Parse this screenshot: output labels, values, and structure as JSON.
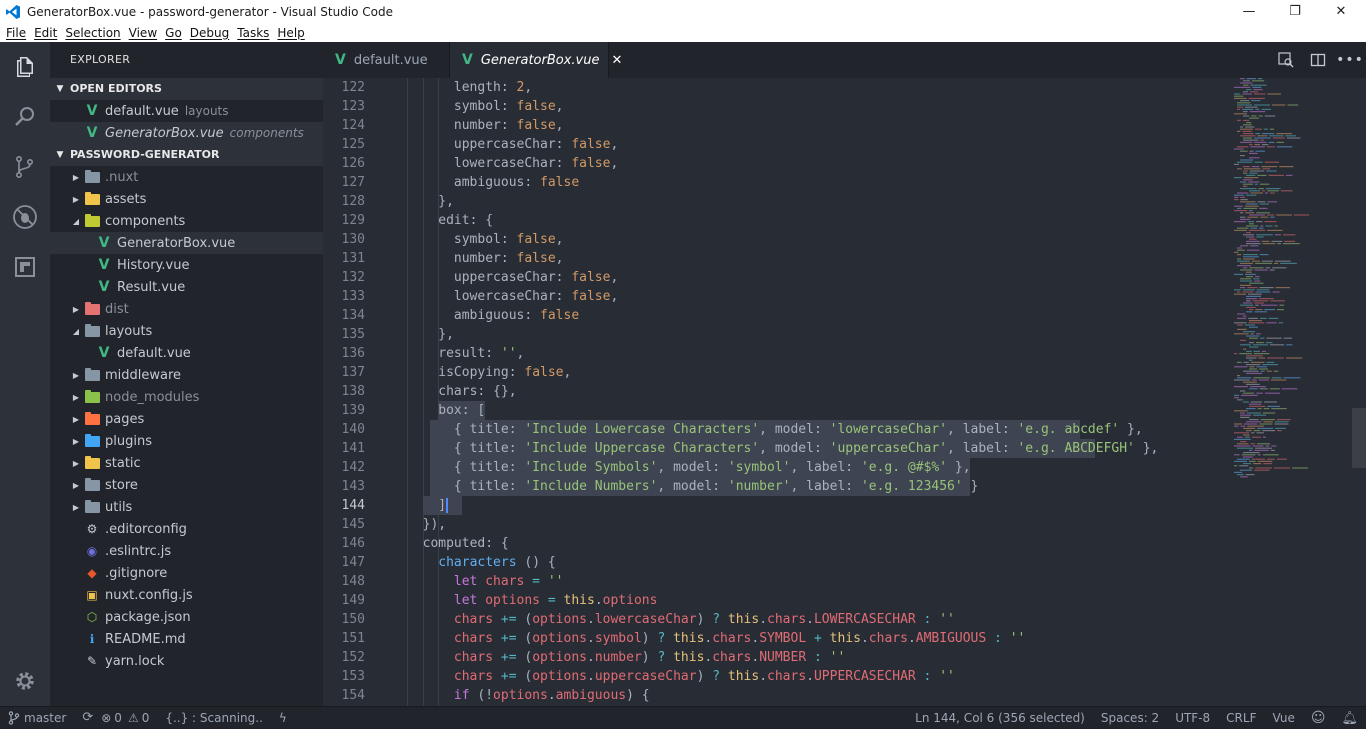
{
  "window": {
    "title": "GeneratorBox.vue - password-generator - Visual Studio Code",
    "minimize": "—",
    "maximize": "❐",
    "close": "✕"
  },
  "menu": [
    "File",
    "Edit",
    "Selection",
    "View",
    "Go",
    "Debug",
    "Tasks",
    "Help"
  ],
  "sidebar": {
    "title": "EXPLORER",
    "open_editors_label": "OPEN EDITORS",
    "open_editors": [
      {
        "name": "default.vue",
        "desc": "layouts"
      },
      {
        "name": "GeneratorBox.vue",
        "desc": "components"
      }
    ],
    "project_label": "PASSWORD-GENERATOR",
    "tree": [
      {
        "name": ".nuxt",
        "type": "folder",
        "expanded": false,
        "depth": 0,
        "color": "#8796a4",
        "dimmed": true
      },
      {
        "name": "assets",
        "type": "folder",
        "expanded": false,
        "depth": 0,
        "color": "#f0c34a"
      },
      {
        "name": "components",
        "type": "folder",
        "expanded": true,
        "depth": 0,
        "color": "#c0ca33"
      },
      {
        "name": "GeneratorBox.vue",
        "type": "vue",
        "depth": 1,
        "active": true
      },
      {
        "name": "History.vue",
        "type": "vue",
        "depth": 1
      },
      {
        "name": "Result.vue",
        "type": "vue",
        "depth": 1
      },
      {
        "name": "dist",
        "type": "folder",
        "expanded": false,
        "depth": 0,
        "color": "#e57373",
        "dimmed": true
      },
      {
        "name": "layouts",
        "type": "folder",
        "expanded": true,
        "depth": 0,
        "color": "#8796a4"
      },
      {
        "name": "default.vue",
        "type": "vue",
        "depth": 1
      },
      {
        "name": "middleware",
        "type": "folder",
        "expanded": false,
        "depth": 0,
        "color": "#8796a4"
      },
      {
        "name": "node_modules",
        "type": "folder",
        "expanded": false,
        "depth": 0,
        "color": "#8bc34a",
        "dimmed": true
      },
      {
        "name": "pages",
        "type": "folder",
        "expanded": false,
        "depth": 0,
        "color": "#ff7043"
      },
      {
        "name": "plugins",
        "type": "folder",
        "expanded": false,
        "depth": 0,
        "color": "#42a5f5"
      },
      {
        "name": "static",
        "type": "folder",
        "expanded": false,
        "depth": 0,
        "color": "#f0c34a"
      },
      {
        "name": "store",
        "type": "folder",
        "expanded": false,
        "depth": 0,
        "color": "#8796a4"
      },
      {
        "name": "utils",
        "type": "folder",
        "expanded": false,
        "depth": 0,
        "color": "#8796a4"
      },
      {
        "name": ".editorconfig",
        "type": "file",
        "depth": 0,
        "icon": "gear"
      },
      {
        "name": ".eslintrc.js",
        "type": "file",
        "depth": 0,
        "icon": "eslint"
      },
      {
        "name": ".gitignore",
        "type": "file",
        "depth": 0,
        "icon": "git"
      },
      {
        "name": "nuxt.config.js",
        "type": "file",
        "depth": 0,
        "icon": "js"
      },
      {
        "name": "package.json",
        "type": "file",
        "depth": 0,
        "icon": "npm"
      },
      {
        "name": "README.md",
        "type": "file",
        "depth": 0,
        "icon": "info"
      },
      {
        "name": "yarn.lock",
        "type": "file",
        "depth": 0,
        "icon": "yarn"
      }
    ]
  },
  "tabs": [
    {
      "name": "default.vue",
      "active": false
    },
    {
      "name": "GeneratorBox.vue",
      "active": true,
      "close": "✕"
    }
  ],
  "editor": {
    "lines": [
      {
        "n": "122",
        "indent": 3,
        "tokens": [
          [
            "k",
            "length"
          ],
          [
            "p",
            ": "
          ],
          [
            "n",
            "2"
          ],
          [
            "p",
            ","
          ]
        ]
      },
      {
        "n": "123",
        "indent": 3,
        "tokens": [
          [
            "k",
            "symbol"
          ],
          [
            "p",
            ": "
          ],
          [
            "b",
            "false"
          ],
          [
            "p",
            ","
          ]
        ]
      },
      {
        "n": "124",
        "indent": 3,
        "tokens": [
          [
            "k",
            "number"
          ],
          [
            "p",
            ": "
          ],
          [
            "b",
            "false"
          ],
          [
            "p",
            ","
          ]
        ]
      },
      {
        "n": "125",
        "indent": 3,
        "tokens": [
          [
            "k",
            "uppercaseChar"
          ],
          [
            "p",
            ": "
          ],
          [
            "b",
            "false"
          ],
          [
            "p",
            ","
          ]
        ]
      },
      {
        "n": "126",
        "indent": 3,
        "tokens": [
          [
            "k",
            "lowercaseChar"
          ],
          [
            "p",
            ": "
          ],
          [
            "b",
            "false"
          ],
          [
            "p",
            ","
          ]
        ]
      },
      {
        "n": "127",
        "indent": 3,
        "tokens": [
          [
            "k",
            "ambiguous"
          ],
          [
            "p",
            ": "
          ],
          [
            "b",
            "false"
          ]
        ]
      },
      {
        "n": "128",
        "indent": 2,
        "tokens": [
          [
            "p",
            "},"
          ]
        ]
      },
      {
        "n": "129",
        "indent": 2,
        "tokens": [
          [
            "k",
            "edit"
          ],
          [
            "p",
            ": {"
          ]
        ]
      },
      {
        "n": "130",
        "indent": 3,
        "tokens": [
          [
            "k",
            "symbol"
          ],
          [
            "p",
            ": "
          ],
          [
            "b",
            "false"
          ],
          [
            "p",
            ","
          ]
        ]
      },
      {
        "n": "131",
        "indent": 3,
        "tokens": [
          [
            "k",
            "number"
          ],
          [
            "p",
            ": "
          ],
          [
            "b",
            "false"
          ],
          [
            "p",
            ","
          ]
        ]
      },
      {
        "n": "132",
        "indent": 3,
        "tokens": [
          [
            "k",
            "uppercaseChar"
          ],
          [
            "p",
            ": "
          ],
          [
            "b",
            "false"
          ],
          [
            "p",
            ","
          ]
        ]
      },
      {
        "n": "133",
        "indent": 3,
        "tokens": [
          [
            "k",
            "lowercaseChar"
          ],
          [
            "p",
            ": "
          ],
          [
            "b",
            "false"
          ],
          [
            "p",
            ","
          ]
        ]
      },
      {
        "n": "134",
        "indent": 3,
        "tokens": [
          [
            "k",
            "ambiguous"
          ],
          [
            "p",
            ": "
          ],
          [
            "b",
            "false"
          ]
        ]
      },
      {
        "n": "135",
        "indent": 2,
        "tokens": [
          [
            "p",
            "},"
          ]
        ]
      },
      {
        "n": "136",
        "indent": 2,
        "tokens": [
          [
            "k",
            "result"
          ],
          [
            "p",
            ": "
          ],
          [
            "s",
            "''"
          ],
          [
            "p",
            ","
          ]
        ]
      },
      {
        "n": "137",
        "indent": 2,
        "tokens": [
          [
            "k",
            "isCopying"
          ],
          [
            "p",
            ": "
          ],
          [
            "b",
            "false"
          ],
          [
            "p",
            ","
          ]
        ]
      },
      {
        "n": "138",
        "indent": 2,
        "tokens": [
          [
            "k",
            "chars"
          ],
          [
            "p",
            ": {},"
          ]
        ]
      },
      {
        "n": "139",
        "indent": 2,
        "sel": [
          0,
          6
        ],
        "tokens": [
          [
            "k",
            "box"
          ],
          [
            "p",
            ": ["
          ]
        ]
      },
      {
        "n": "140",
        "indent": 3,
        "sel": [
          -3,
          80
        ],
        "tokens": [
          [
            "p",
            "{ "
          ],
          [
            "k",
            "title"
          ],
          [
            "p",
            ": "
          ],
          [
            "s",
            "'Include Lowercase Characters'"
          ],
          [
            "p",
            ", "
          ],
          [
            "k",
            "model"
          ],
          [
            "p",
            ": "
          ],
          [
            "s",
            "'lowercaseChar'"
          ],
          [
            "p",
            ", "
          ],
          [
            "k",
            "label"
          ],
          [
            "p",
            ": "
          ],
          [
            "s",
            "'e.g. abcdef'"
          ],
          [
            "p",
            " },"
          ]
        ]
      },
      {
        "n": "141",
        "indent": 3,
        "sel": [
          -3,
          82
        ],
        "tokens": [
          [
            "p",
            "{ "
          ],
          [
            "k",
            "title"
          ],
          [
            "p",
            ": "
          ],
          [
            "s",
            "'Include Uppercase Characters'"
          ],
          [
            "p",
            ", "
          ],
          [
            "k",
            "model"
          ],
          [
            "p",
            ": "
          ],
          [
            "s",
            "'uppercaseChar'"
          ],
          [
            "p",
            ", "
          ],
          [
            "k",
            "label"
          ],
          [
            "p",
            ": "
          ],
          [
            "s",
            "'e.g. ABCDEFGH'"
          ],
          [
            "p",
            " },"
          ]
        ]
      },
      {
        "n": "142",
        "indent": 3,
        "sel": [
          -3,
          66
        ],
        "tokens": [
          [
            "p",
            "{ "
          ],
          [
            "k",
            "title"
          ],
          [
            "p",
            ": "
          ],
          [
            "s",
            "'Include Symbols'"
          ],
          [
            "p",
            ", "
          ],
          [
            "k",
            "model"
          ],
          [
            "p",
            ": "
          ],
          [
            "s",
            "'symbol'"
          ],
          [
            "p",
            ", "
          ],
          [
            "k",
            "label"
          ],
          [
            "p",
            ": "
          ],
          [
            "s",
            "'e.g. @#$%'"
          ],
          [
            "p",
            " },"
          ]
        ]
      },
      {
        "n": "143",
        "indent": 3,
        "sel": [
          -3,
          66
        ],
        "tokens": [
          [
            "p",
            "{ "
          ],
          [
            "k",
            "title"
          ],
          [
            "p",
            ": "
          ],
          [
            "s",
            "'Include Numbers'"
          ],
          [
            "p",
            ", "
          ],
          [
            "k",
            "model"
          ],
          [
            "p",
            ": "
          ],
          [
            "s",
            "'number'"
          ],
          [
            "p",
            ", "
          ],
          [
            "k",
            "label"
          ],
          [
            "p",
            ": "
          ],
          [
            "s",
            "'e.g. 123456'"
          ],
          [
            "p",
            " }"
          ]
        ]
      },
      {
        "n": "144",
        "indent": 2,
        "sel": [
          -2,
          3
        ],
        "tokens": [
          [
            "p",
            "]"
          ]
        ]
      },
      {
        "n": "145",
        "indent": 1,
        "tokens": [
          [
            "p",
            "}),"
          ]
        ]
      },
      {
        "n": "146",
        "indent": 1,
        "tokens": [
          [
            "k",
            "computed"
          ],
          [
            "p",
            ": {"
          ]
        ]
      },
      {
        "n": "147",
        "indent": 2,
        "tokens": [
          [
            "f",
            "characters"
          ],
          [
            "p",
            " () {"
          ]
        ]
      },
      {
        "n": "148",
        "indent": 3,
        "tokens": [
          [
            "w",
            "let "
          ],
          [
            "v",
            "chars"
          ],
          [
            "o",
            " = "
          ],
          [
            "s",
            "''"
          ]
        ]
      },
      {
        "n": "149",
        "indent": 3,
        "tokens": [
          [
            "w",
            "let "
          ],
          [
            "v",
            "options"
          ],
          [
            "o",
            " = "
          ],
          [
            "t",
            "this"
          ],
          [
            "p",
            "."
          ],
          [
            "v",
            "options"
          ]
        ]
      },
      {
        "n": "150",
        "indent": 3,
        "tokens": [
          [
            "v",
            "chars"
          ],
          [
            "o",
            " += "
          ],
          [
            "p",
            "("
          ],
          [
            "v",
            "options"
          ],
          [
            "p",
            "."
          ],
          [
            "v",
            "lowercaseChar"
          ],
          [
            "p",
            ") "
          ],
          [
            "o",
            "? "
          ],
          [
            "t",
            "this"
          ],
          [
            "p",
            "."
          ],
          [
            "v",
            "chars"
          ],
          [
            "p",
            "."
          ],
          [
            "v",
            "LOWERCASECHAR"
          ],
          [
            "o",
            " : "
          ],
          [
            "s",
            "''"
          ]
        ]
      },
      {
        "n": "151",
        "indent": 3,
        "tokens": [
          [
            "v",
            "chars"
          ],
          [
            "o",
            " += "
          ],
          [
            "p",
            "("
          ],
          [
            "v",
            "options"
          ],
          [
            "p",
            "."
          ],
          [
            "v",
            "symbol"
          ],
          [
            "p",
            ") "
          ],
          [
            "o",
            "? "
          ],
          [
            "t",
            "this"
          ],
          [
            "p",
            "."
          ],
          [
            "v",
            "chars"
          ],
          [
            "p",
            "."
          ],
          [
            "v",
            "SYMBOL"
          ],
          [
            "o",
            " + "
          ],
          [
            "t",
            "this"
          ],
          [
            "p",
            "."
          ],
          [
            "v",
            "chars"
          ],
          [
            "p",
            "."
          ],
          [
            "v",
            "AMBIGUOUS"
          ],
          [
            "o",
            " : "
          ],
          [
            "s",
            "''"
          ]
        ]
      },
      {
        "n": "152",
        "indent": 3,
        "tokens": [
          [
            "v",
            "chars"
          ],
          [
            "o",
            " += "
          ],
          [
            "p",
            "("
          ],
          [
            "v",
            "options"
          ],
          [
            "p",
            "."
          ],
          [
            "v",
            "number"
          ],
          [
            "p",
            ") "
          ],
          [
            "o",
            "? "
          ],
          [
            "t",
            "this"
          ],
          [
            "p",
            "."
          ],
          [
            "v",
            "chars"
          ],
          [
            "p",
            "."
          ],
          [
            "v",
            "NUMBER"
          ],
          [
            "o",
            " : "
          ],
          [
            "s",
            "''"
          ]
        ]
      },
      {
        "n": "153",
        "indent": 3,
        "tokens": [
          [
            "v",
            "chars"
          ],
          [
            "o",
            " += "
          ],
          [
            "p",
            "("
          ],
          [
            "v",
            "options"
          ],
          [
            "p",
            "."
          ],
          [
            "v",
            "uppercaseChar"
          ],
          [
            "p",
            ") "
          ],
          [
            "o",
            "? "
          ],
          [
            "t",
            "this"
          ],
          [
            "p",
            "."
          ],
          [
            "v",
            "chars"
          ],
          [
            "p",
            "."
          ],
          [
            "v",
            "UPPERCASECHAR"
          ],
          [
            "o",
            " : "
          ],
          [
            "s",
            "''"
          ]
        ]
      },
      {
        "n": "154",
        "indent": 3,
        "tokens": [
          [
            "w",
            "if "
          ],
          [
            "p",
            "(!"
          ],
          [
            "v",
            "options"
          ],
          [
            "p",
            "."
          ],
          [
            "v",
            "ambiguous"
          ],
          [
            "p",
            ") {"
          ]
        ]
      }
    ]
  },
  "status": {
    "branch": "master",
    "errors": "0",
    "warnings": "0",
    "scanning": "{..} : Scanning..",
    "position": "Ln 144, Col 6 (356 selected)",
    "spaces": "Spaces: 2",
    "encoding": "UTF-8",
    "eol": "CRLF",
    "language": "Vue"
  },
  "colors": {
    "vue_green": "#41b883",
    "bg_editor": "#282c34",
    "bg_sidebar": "#21252b"
  }
}
